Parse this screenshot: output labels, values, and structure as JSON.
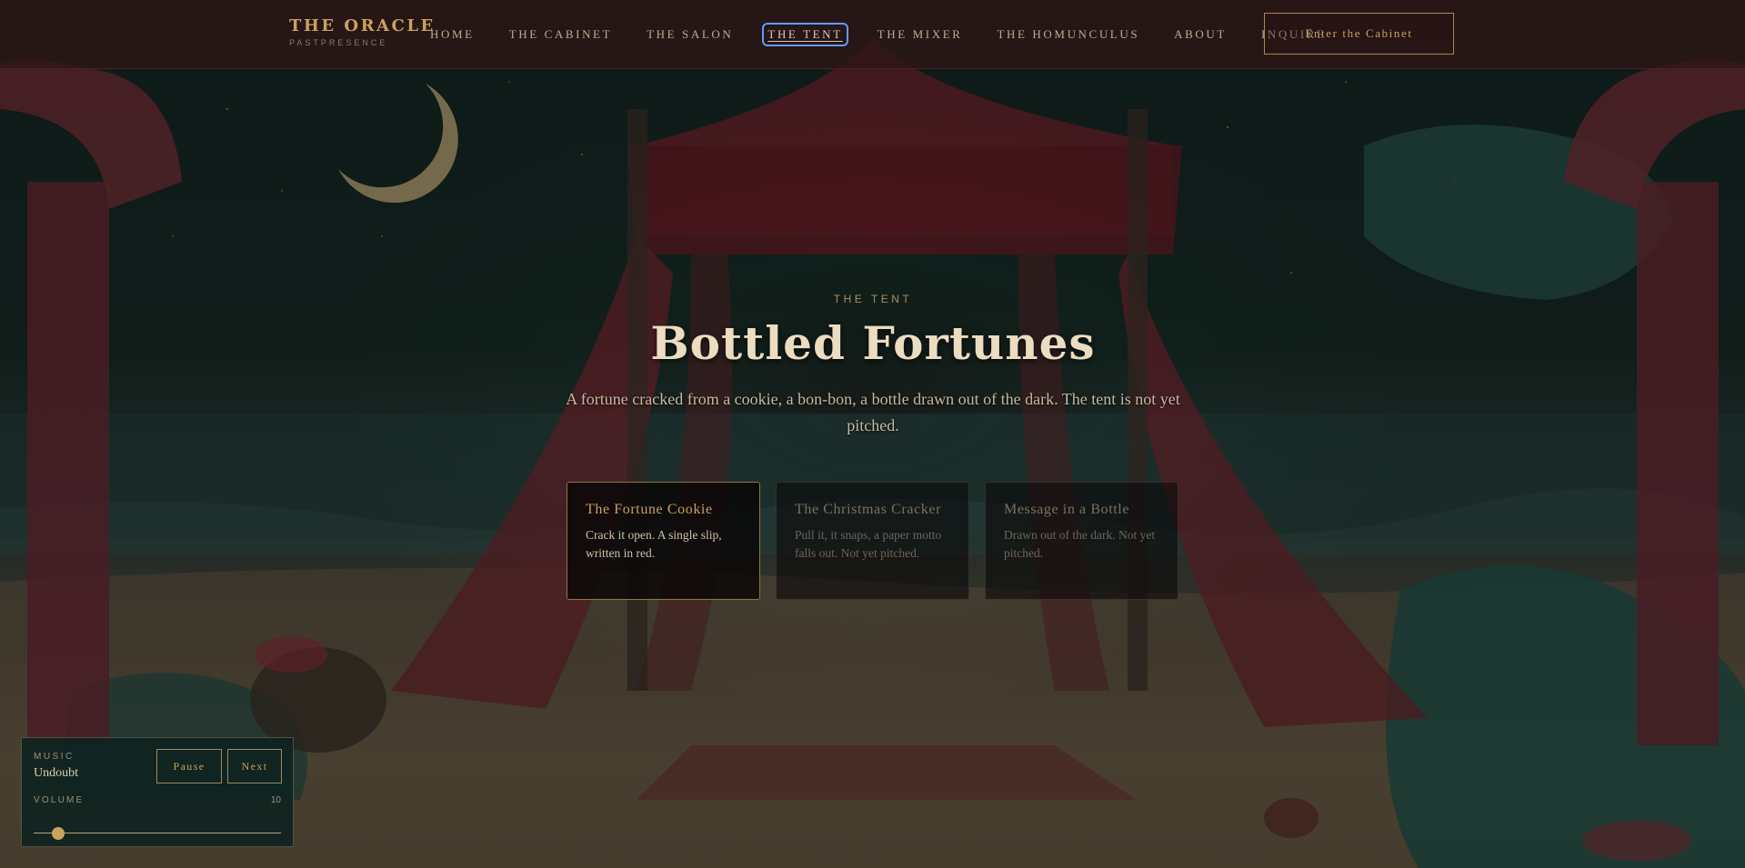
{
  "brand": {
    "title": "THE ORACLE",
    "subtitle": "PASTPRESENCE"
  },
  "nav": {
    "items": [
      {
        "label": "HOME"
      },
      {
        "label": "THE CABINET"
      },
      {
        "label": "THE SALON"
      },
      {
        "label": "THE TENT",
        "active": true
      },
      {
        "label": "THE MIXER"
      },
      {
        "label": "THE HOMUNCULUS"
      },
      {
        "label": "ABOUT"
      },
      {
        "label": "INQUIRE"
      }
    ],
    "cta_label": "Enter the Cabinet"
  },
  "hero": {
    "eyebrow": "THE TENT",
    "title": "Bottled Fortunes",
    "description": "A fortune cracked from a cookie, a bon-bon, a bottle drawn out of the dark. The tent is not yet pitched."
  },
  "cards": [
    {
      "title": "The Fortune Cookie",
      "description": "Crack it open. A single slip, written in red.",
      "state": "active"
    },
    {
      "title": "The Christmas Cracker",
      "description": "Pull it, it snaps, a paper motto falls out. Not yet pitched.",
      "state": "dim"
    },
    {
      "title": "Message in a Bottle",
      "description": "Drawn out of the dark. Not yet pitched.",
      "state": "dim"
    }
  ],
  "player": {
    "label": "MUSIC",
    "track": "Undoubt",
    "pause_label": "Pause",
    "next_label": "Next",
    "volume_label": "VOLUME",
    "volume_value": "10",
    "volume_fraction": 0.1
  },
  "colors": {
    "accent_gold": "#c9a25c",
    "nav_bg": "#2e1416",
    "tent_red": "#7a2a32",
    "sea_teal": "#1f4a45",
    "active_outline": "#5d9cff"
  }
}
